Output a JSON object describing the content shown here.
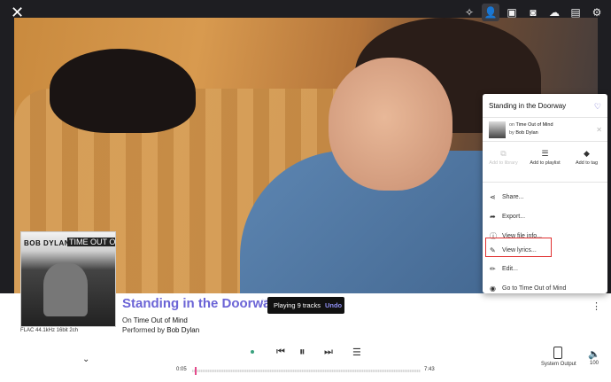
{
  "header": {
    "close_glyph": "✕",
    "toolbar_icons": [
      "wand-icon",
      "user-icon",
      "radio-icon",
      "camera-icon",
      "cloud-icon",
      "folder-icon",
      "settings-icon"
    ],
    "active_toolbar_index": 1
  },
  "album": {
    "cover_artist": "BOB DYLAN",
    "cover_title": "TIME OUT OF MIND",
    "format": "FLAC 44.1kHz 16bit 2ch"
  },
  "track": {
    "title": "Standing in the Doorway",
    "on_prefix": "On ",
    "album_name": "Time Out of Mind",
    "performed_prefix": "Performed by ",
    "artist": "Bob Dylan"
  },
  "toast": {
    "message": "Playing 9 tracks",
    "undo_label": "Undo"
  },
  "playback": {
    "elapsed": "0:05",
    "duration": "7:43",
    "progress_fraction": 0.011
  },
  "output": {
    "device_label": "System Output",
    "volume_label": "100"
  },
  "menu": {
    "title": "Standing in the Doorway",
    "on_text": "on ",
    "album": "Time Out of Mind",
    "by_text": "by ",
    "artist": "Bob Dylan",
    "actions": [
      {
        "icon": "library-icon",
        "glyph": "⧉",
        "label": "Add to library",
        "disabled": true
      },
      {
        "icon": "playlist-icon",
        "glyph": "☰",
        "label": "Add to playlist",
        "disabled": false
      },
      {
        "icon": "tag-icon",
        "glyph": "◆",
        "label": "Add to tag",
        "disabled": false
      }
    ],
    "items": [
      {
        "icon": "share-icon",
        "glyph": "⋖",
        "label": "Share..."
      },
      {
        "icon": "export-icon",
        "glyph": "➦",
        "label": "Export..."
      },
      {
        "icon": "info-icon",
        "glyph": "ⓘ",
        "label": "View file info..."
      },
      {
        "icon": "microphone-icon",
        "glyph": "✎",
        "label": "View lyrics..."
      },
      {
        "icon": "edit-icon",
        "glyph": "✏",
        "label": "Edit..."
      },
      {
        "icon": "album-icon",
        "glyph": "◉",
        "label": "Go to Time Out of Mind"
      }
    ]
  }
}
